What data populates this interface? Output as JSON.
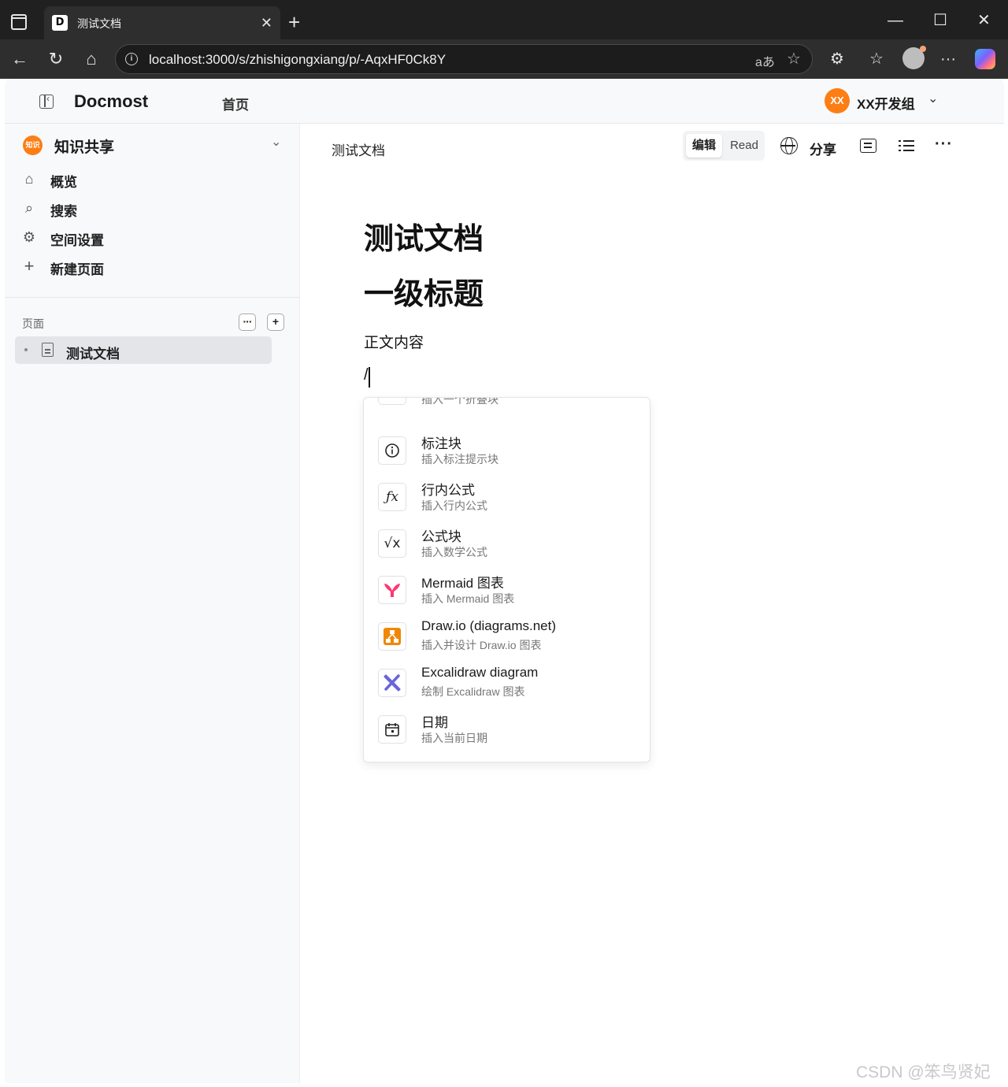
{
  "browser": {
    "tab_favicon": "D",
    "tab_title": "测试文档",
    "url": "localhost:3000/s/zhishigongxiang/p/-AqxHF0Ck8Y",
    "translate_glyph": "aあ"
  },
  "header": {
    "brand": "Docmost",
    "home_link": "首页",
    "workspace_initials": "XX",
    "workspace_name": "XX开发组"
  },
  "sidebar": {
    "space_avatar": "知识",
    "space_name": "知识共享",
    "items": [
      {
        "label": "概览",
        "icon": "home-icon"
      },
      {
        "label": "搜索",
        "icon": "search-icon"
      },
      {
        "label": "空间设置",
        "icon": "gear-icon"
      },
      {
        "label": "新建页面",
        "icon": "plus-icon"
      }
    ],
    "pages_label": "页面",
    "pages": [
      {
        "label": "测试文档"
      }
    ]
  },
  "doc_header": {
    "title": "测试文档",
    "mode_edit": "编辑",
    "mode_read": "Read",
    "share": "分享"
  },
  "document": {
    "title": "测试文档",
    "heading1": "一级标题",
    "body": "正文内容",
    "slash": "/"
  },
  "slash_menu": {
    "partial_item_desc": "插入一个折叠块",
    "items": [
      {
        "title": "标注块",
        "desc": "插入标注提示块",
        "icon": "info-icon"
      },
      {
        "title": "行内公式",
        "desc": "插入行内公式",
        "icon": "function-icon"
      },
      {
        "title": "公式块",
        "desc": "插入数学公式",
        "icon": "sqrt-icon"
      },
      {
        "title": "Mermaid 图表",
        "desc": "插入 Mermaid 图表",
        "icon": "mermaid-icon"
      },
      {
        "title": "Draw.io (diagrams.net)",
        "desc": "插入并设计 Draw.io 图表",
        "icon": "drawio-icon"
      },
      {
        "title": "Excalidraw diagram",
        "desc": "绘制 Excalidraw 图表",
        "icon": "excalidraw-icon"
      },
      {
        "title": "日期",
        "desc": "插入当前日期",
        "icon": "calendar-icon"
      }
    ]
  },
  "colors": {
    "accent": "#fd7e14",
    "mermaid": "#ff3670",
    "drawio": "#f08705",
    "excalidraw": "#6965db"
  },
  "watermark": "CSDN @笨鸟贤妃"
}
